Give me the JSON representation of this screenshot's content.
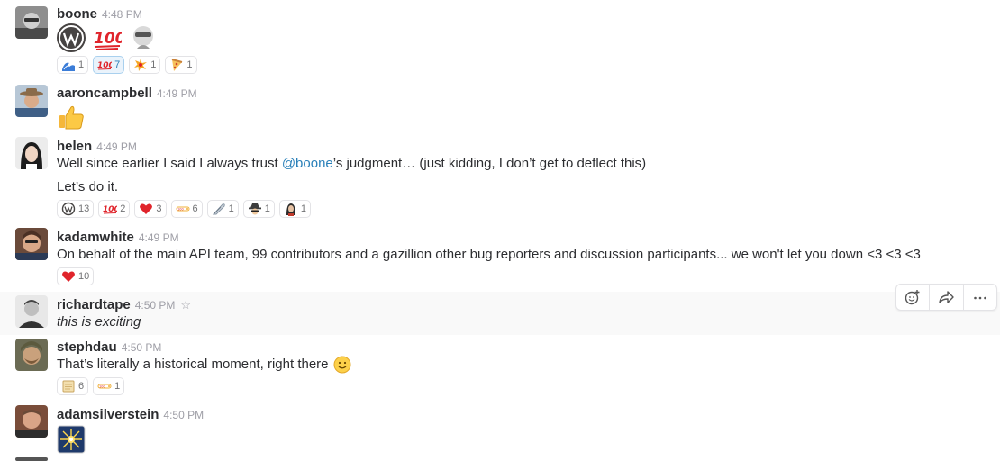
{
  "messages": [
    {
      "user": "boone",
      "time": "4:48 PM",
      "reactions": [
        {
          "icon": "wave-icon",
          "count": "1"
        },
        {
          "icon": "hundred-icon",
          "count": "7"
        },
        {
          "icon": "collision-icon",
          "count": "1"
        },
        {
          "icon": "pizza-icon",
          "count": "1"
        }
      ]
    },
    {
      "user": "aaroncampbell",
      "time": "4:49 PM"
    },
    {
      "user": "helen",
      "time": "4:49 PM",
      "line1_before": "Well since earlier I said I always trust ",
      "mention": "@boone",
      "line1_after": "’s judgment… (just kidding, I don’t get to deflect this)",
      "line2": "Let’s do it.",
      "reactions": [
        {
          "icon": "wordpress-icon",
          "count": "13"
        },
        {
          "icon": "hundred-icon",
          "count": "2"
        },
        {
          "icon": "heart-icon",
          "count": "3"
        },
        {
          "icon": "trophy-icon",
          "count": "6"
        },
        {
          "icon": "feather-icon",
          "count": "1"
        },
        {
          "icon": "spy-icon",
          "count": "1"
        },
        {
          "icon": "woman-icon",
          "count": "1"
        }
      ]
    },
    {
      "user": "kadamwhite",
      "time": "4:49 PM",
      "text": "On behalf of the main API team, 99 contributors and a gazillion other bug reporters and discussion participants... we won't let you down <3 <3 <3",
      "reactions": [
        {
          "icon": "heart-icon",
          "count": "10"
        }
      ]
    },
    {
      "user": "richardtape",
      "time": "4:50 PM",
      "text": "this is exciting"
    },
    {
      "user": "stephdau",
      "time": "4:50 PM",
      "text": "That’s literally a historical moment, right there",
      "reactions": [
        {
          "icon": "scroll-icon",
          "count": "6"
        },
        {
          "icon": "trophy-icon",
          "count": "1"
        }
      ]
    },
    {
      "user": "adamsilverstein",
      "time": "4:50 PM"
    }
  ]
}
